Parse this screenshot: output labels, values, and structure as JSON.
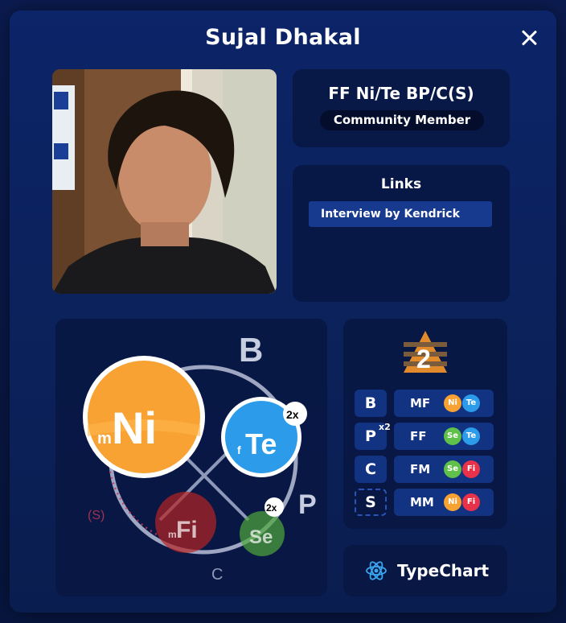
{
  "profile": {
    "name": "Sujal Dhakal",
    "type_code": "FF Ni/Te BP/C(S)",
    "role": "Community Member"
  },
  "links": {
    "title": "Links",
    "items": [
      {
        "label": "Interview by Kendrick"
      }
    ]
  },
  "chart": {
    "labels": {
      "b": "B",
      "p": "P",
      "c": "C",
      "s": "(S)"
    },
    "functions": [
      {
        "prefix": "m",
        "name": "Ni",
        "color": "#f7a233"
      },
      {
        "prefix": "f",
        "name": "Te",
        "color": "#2b9bea",
        "badge": "2x"
      },
      {
        "prefix": "m",
        "name": "Fi",
        "color": "#c62828"
      },
      {
        "prefix": "",
        "name": "Se",
        "color": "#5fc04a",
        "badge": "2x"
      }
    ]
  },
  "stats": {
    "level": "2",
    "rows": [
      {
        "letter": "B",
        "label": "MF",
        "dots": [
          {
            "t": "Ni",
            "c": "#f7a233"
          },
          {
            "t": "Te",
            "c": "#2b9bea"
          }
        ]
      },
      {
        "letter": "P",
        "sup": "x2",
        "label": "FF",
        "dots": [
          {
            "t": "Se",
            "c": "#5fc04a"
          },
          {
            "t": "Te",
            "c": "#2b9bea"
          }
        ]
      },
      {
        "letter": "C",
        "label": "FM",
        "dots": [
          {
            "t": "Se",
            "c": "#5fc04a"
          },
          {
            "t": "Fi",
            "c": "#e8324a"
          }
        ]
      },
      {
        "letter": "S",
        "label": "MM",
        "dots": [
          {
            "t": "Ni",
            "c": "#f7a233"
          },
          {
            "t": "Fi",
            "c": "#e8324a"
          }
        ]
      }
    ]
  },
  "brand": {
    "label": "TypeChart"
  }
}
